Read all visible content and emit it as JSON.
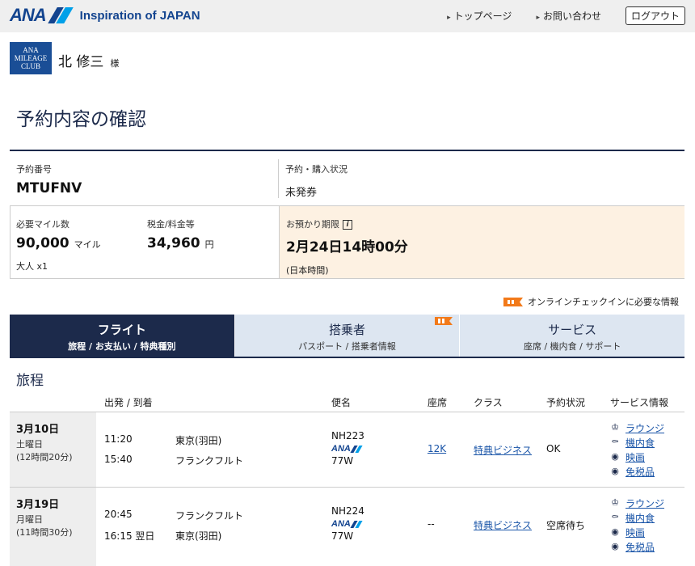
{
  "header": {
    "logo_text": "ANA",
    "tagline": "Inspiration of JAPAN",
    "links": [
      "トップページ",
      "お問い合わせ"
    ],
    "logout_label": "ログアウト",
    "colors": {
      "brand": "#13448f",
      "accent": "#00a0e9",
      "navy": "#1c2a4b"
    }
  },
  "member": {
    "club_badge": [
      "ANA",
      "MILEAGE",
      "CLUB"
    ],
    "name": "北 修三",
    "honorific": "様"
  },
  "page_title": "予約内容の確認",
  "booking": {
    "ref_label": "予約番号",
    "ref_value": "MTUFNV",
    "status_label": "予約・購入状況",
    "status_value": "未発券",
    "miles_label": "必要マイル数",
    "miles_value": "90,000",
    "miles_unit": "マイル",
    "passengers": "大人 x1",
    "tax_label": "税金/料金等",
    "tax_value": "34,960",
    "tax_unit": "円",
    "deadline_label": "お預かり期限",
    "deadline_value": "2月24日14時00分",
    "deadline_tz": "(日本時間)",
    "info_glyph": "i"
  },
  "checkin_note": "オンラインチェックインに必要な情報",
  "tabs": [
    {
      "title": "フライト",
      "sub": "旅程 / お支払い / 特典種別",
      "active": true
    },
    {
      "title": "搭乗者",
      "sub": "パスポート / 搭乗者情報",
      "active": false
    },
    {
      "title": "サービス",
      "sub": "座席 / 機内食 / サポート",
      "active": false
    }
  ],
  "itinerary": {
    "title": "旅程",
    "columns": [
      "出発 / 到着",
      "便名",
      "座席",
      "クラス",
      "予約状況",
      "サービス情報"
    ],
    "segments": [
      {
        "date": "3月10日",
        "weekday": "土曜日",
        "duration": "(12時間20分)",
        "dep_time": "11:20",
        "dep_city": "東京(羽田)",
        "arr_time": "15:40",
        "arr_city": "フランクフルト",
        "flight": "NH223",
        "airline": "ANA",
        "aircraft": "77W",
        "seat": "12K",
        "seat_link": true,
        "class": "特典ビジネス",
        "status": "OK",
        "services": [
          "ラウンジ",
          "機内食",
          "映画",
          "免税品"
        ]
      },
      {
        "date": "3月19日",
        "weekday": "月曜日",
        "duration": "(11時間30分)",
        "dep_time": "20:45",
        "dep_city": "フランクフルト",
        "arr_time": "16:15 翌日",
        "arr_city": "東京(羽田)",
        "flight": "NH224",
        "airline": "ANA",
        "aircraft": "77W",
        "seat": "--",
        "seat_link": false,
        "class": "特典ビジネス",
        "status": "空席待ち",
        "services": [
          "ラウンジ",
          "機内食",
          "映画",
          "免税品"
        ]
      }
    ],
    "service_icons": [
      "lounge-icon",
      "meal-icon",
      "movie-icon",
      "duty-free-icon"
    ]
  }
}
